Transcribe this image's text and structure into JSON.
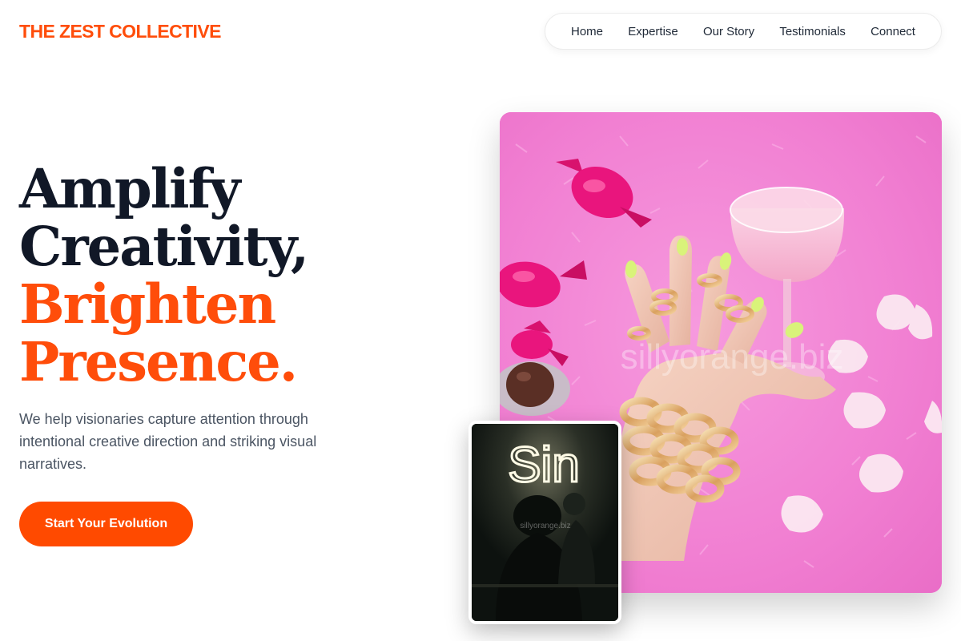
{
  "header": {
    "brand": "THE ZEST COLLECTIVE",
    "nav": [
      {
        "label": "Home"
      },
      {
        "label": "Expertise"
      },
      {
        "label": "Our Story"
      },
      {
        "label": "Testimonials"
      },
      {
        "label": "Connect"
      }
    ]
  },
  "hero": {
    "headline": {
      "line1": "Amplify",
      "line2": "Creativity,",
      "line3": "Brighten",
      "line4": "Presence."
    },
    "subtext": "We help visionaries capture attention through intentional creative direction and striking visual narratives.",
    "cta_label": "Start Your Evolution"
  },
  "images": {
    "main_watermark": "sillyorange.biz",
    "neon_text": "Sin",
    "small_watermark": "sillyorange.biz"
  },
  "colors": {
    "accent": "#ff4d0a",
    "headline_dark": "#111827",
    "body_text": "#4b5563",
    "button_bg": "#ff4a00"
  }
}
